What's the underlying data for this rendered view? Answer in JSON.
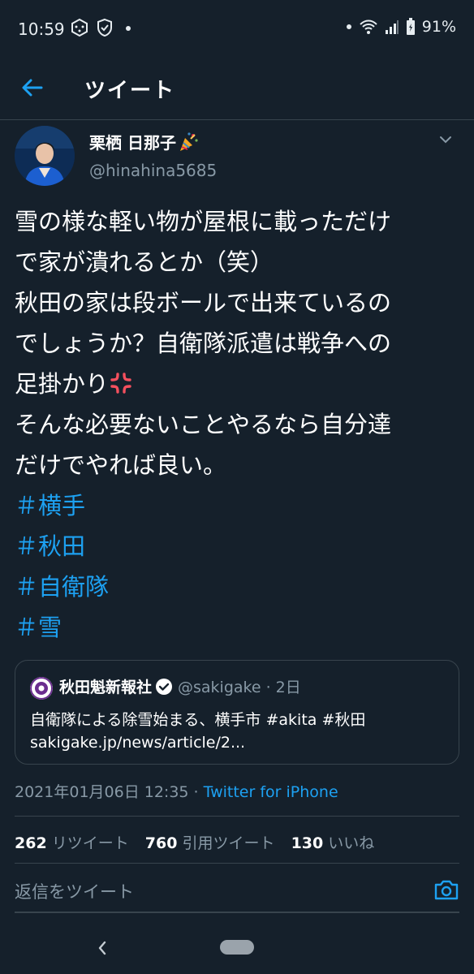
{
  "status_bar": {
    "time": "10:59",
    "battery": "91%"
  },
  "header": {
    "title": "ツイート"
  },
  "author": {
    "name": "栗栖 日那子",
    "handle": "@hinahina5685"
  },
  "tweet": {
    "lines": [
      "雪の様な軽い物が屋根に載っただけ",
      "で家が潰れるとか（笑）",
      "秋田の家は段ボールで出来ているの",
      "でしょうか？自衛隊派遣は戦争への",
      "足掛かり",
      "そんな必要ないことやるなら自分達",
      "だけでやれば良い。"
    ],
    "hashtags": [
      "＃横手",
      "＃秋田",
      "＃自衛隊",
      "＃雪"
    ]
  },
  "quote": {
    "name": "秋田魁新報社",
    "handle": "@sakigake",
    "time": "· 2日",
    "text": "自衛隊による除雪始まる、横手市 #akita #秋田",
    "link": "sakigake.jp/news/article/2..."
  },
  "timestamp": {
    "date": "2021年01月06日 12:35 · ",
    "source": "Twitter for iPhone"
  },
  "stats": {
    "retweets_count": "262",
    "retweets_label": "リツイート",
    "quotes_count": "760",
    "quotes_label": "引用ツイート",
    "likes_count": "130",
    "likes_label": "いいね"
  },
  "reply": {
    "placeholder": "返信をツイート"
  },
  "colors": {
    "background": "#15202b",
    "accent": "#1da1f2",
    "secondary_text": "#8899a6",
    "border": "#38444d"
  },
  "icons": [
    "back-arrow-icon",
    "party-popper-icon",
    "chevron-down-icon",
    "anger-icon",
    "verified-icon",
    "camera-icon",
    "wifi-icon",
    "battery-icon"
  ]
}
